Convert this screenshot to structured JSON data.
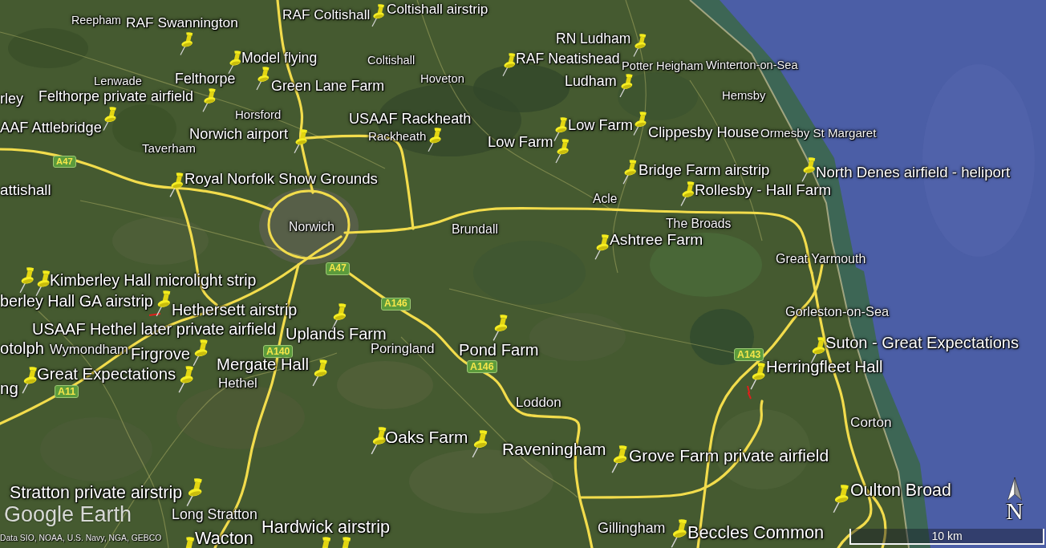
{
  "map": {
    "placemark_labels": [
      "RAF Swannington",
      "RAF Coltishall",
      "Coltishall airstrip",
      "RN Ludham",
      "Model flying",
      "RAF Neatishead",
      "Felthorpe",
      "Green Lane Farm",
      "Ludham",
      "rley",
      "Felthorpe private airfield",
      "AAF Attlebridge",
      "USAAF Rackheath",
      "Norwich airport",
      "Low Farm",
      "Low Farm",
      "Clippesby House",
      "Royal Norfolk Show Grounds",
      "Bridge Farm airstrip",
      "North Denes airfield - heliport",
      "attishall",
      "Rollesby - Hall Farm",
      "Ashtree Farm",
      "Kimberley Hall microlight strip",
      "berley Hall GA airstrip",
      "Hethersett airstrip",
      "USAAF Hethel later private airfield",
      "Uplands Farm",
      "otolph",
      "Firgrove",
      "Pond Farm",
      "Suton - Great Expectations",
      "Mergate Hall",
      "Great Expectations",
      "Herringfleet Hall",
      "ng",
      "Oaks Farm",
      "Raveningham",
      "Grove Farm private airfield",
      "Stratton private airstrip",
      "Oulton Broad",
      "Wacton",
      "Hardwick airstrip",
      "Beccles Common"
    ],
    "place_labels": [
      "Reepham",
      "Coltishall",
      "Potter Heigham",
      "Winterton-on-Sea",
      "Lenwade",
      "Hoveton",
      "Hemsby",
      "Horsford",
      "Rackheath",
      "Ormesby St Margaret",
      "Taverham",
      "Acle",
      "Norwich",
      "Brundall",
      "The Broads",
      "Great Yarmouth",
      "Gorleston-on-Sea",
      "Wymondham",
      "Poringland",
      "Hethel",
      "Loddon",
      "Corton",
      "Long Stratton",
      "Gillingham"
    ],
    "road_shields": [
      "A47",
      "A47",
      "A146",
      "A140",
      "A143",
      "A146",
      "A11"
    ]
  },
  "logo": "Google Earth",
  "attribution": "Data SIO, NOAA, U.S. Navy, NGA, GEBCO",
  "scale_bar": "10 km",
  "compass": "N"
}
